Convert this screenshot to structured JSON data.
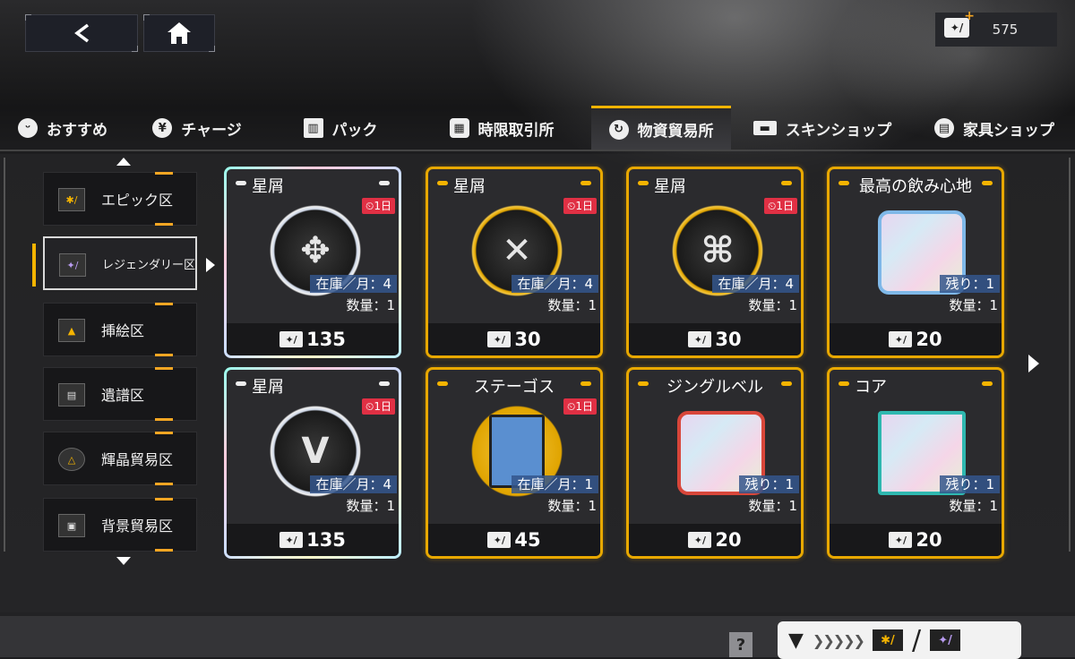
{
  "header": {
    "back_icon": "chevron-left-icon",
    "home_icon": "home-icon",
    "currency": {
      "icon": "ticket-icon",
      "value": "575"
    }
  },
  "tabs": [
    {
      "label": "おすすめ",
      "icon": "bunny-icon",
      "active": false
    },
    {
      "label": "チャージ",
      "icon": "yen-icon",
      "active": false
    },
    {
      "label": "パック",
      "icon": "gift-icon",
      "active": false
    },
    {
      "label": "時限取引所",
      "icon": "grid-icon",
      "active": false
    },
    {
      "label": "物資貿易所",
      "icon": "refresh-icon",
      "active": true
    },
    {
      "label": "スキンショップ",
      "icon": "card-icon",
      "active": false
    },
    {
      "label": "家具ショップ",
      "icon": "sofa-icon",
      "active": false
    }
  ],
  "sidebar": {
    "items": [
      {
        "label": "エピック区",
        "icon": "epic-ticket-icon",
        "active": false
      },
      {
        "label": "レジェンダリー区",
        "icon": "legendary-ticket-icon",
        "active": true
      },
      {
        "label": "挿絵区",
        "icon": "illustration-icon",
        "active": false
      },
      {
        "label": "遺譜区",
        "icon": "score-icon",
        "active": false
      },
      {
        "label": "輝晶貿易区",
        "icon": "crystal-icon",
        "active": false
      },
      {
        "label": "背景貿易区",
        "icon": "background-icon",
        "active": false
      }
    ]
  },
  "cards": [
    {
      "name": "星屑",
      "timer": "1日",
      "stock": "在庫／月：4",
      "qty": "数量：1",
      "price": "135",
      "style": "rainbow",
      "art": "emblem"
    },
    {
      "name": "星屑",
      "timer": "1日",
      "stock": "在庫／月：4",
      "qty": "数量：1",
      "price": "30",
      "style": "gold",
      "art": "emblem"
    },
    {
      "name": "星屑",
      "timer": "1日",
      "stock": "在庫／月：4",
      "qty": "数量：1",
      "price": "30",
      "style": "gold",
      "art": "emblem"
    },
    {
      "name": "最高の飲み心地",
      "timer": "",
      "stock": "残り：1",
      "qty": "数量：1",
      "price": "20",
      "style": "gold",
      "art": "frame"
    },
    {
      "name": "星屑",
      "timer": "1日",
      "stock": "在庫／月：4",
      "qty": "数量：1",
      "price": "135",
      "style": "rainbow",
      "art": "emblem"
    },
    {
      "name": "ステーゴス",
      "timer": "1日",
      "stock": "在庫／月：1",
      "qty": "数量：1",
      "price": "45",
      "style": "gold",
      "art": "card"
    },
    {
      "name": "ジングルベル",
      "timer": "",
      "stock": "残り：1",
      "qty": "数量：1",
      "price": "20",
      "style": "gold",
      "art": "frame"
    },
    {
      "name": "コア",
      "timer": "",
      "stock": "残り：1",
      "qty": "数量：1",
      "price": "20",
      "style": "gold",
      "art": "frame"
    }
  ],
  "footer": {
    "help_label": "?"
  }
}
